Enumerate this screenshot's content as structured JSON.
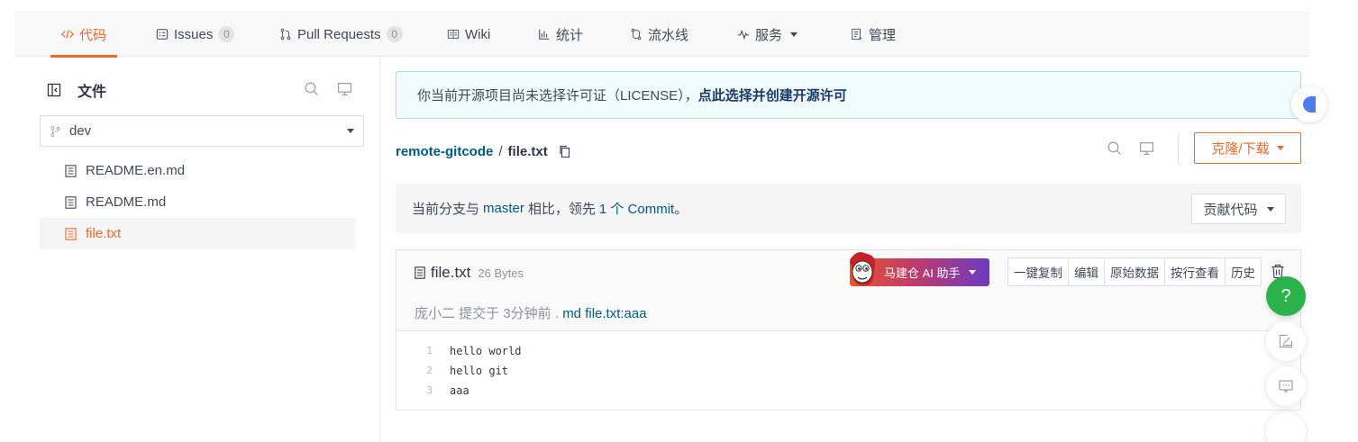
{
  "nav": {
    "tabs": [
      {
        "label": "代码",
        "icon": "code-icon",
        "active": true
      },
      {
        "label": "Issues",
        "icon": "issues-icon",
        "count": "0"
      },
      {
        "label": "Pull Requests",
        "icon": "pull-request-icon",
        "count": "0"
      },
      {
        "label": "Wiki",
        "icon": "wiki-icon"
      },
      {
        "label": "统计",
        "icon": "chart-icon"
      },
      {
        "label": "流水线",
        "icon": "pipeline-icon"
      },
      {
        "label": "服务",
        "icon": "pulse-icon"
      },
      {
        "label": "管理",
        "icon": "manage-icon"
      }
    ]
  },
  "sidebar": {
    "title": "文件",
    "branch": "dev",
    "files": [
      {
        "name": "README.en.md"
      },
      {
        "name": "README.md"
      },
      {
        "name": "file.txt",
        "active": true
      }
    ]
  },
  "license": {
    "text": "你当前开源项目尚未选择许可证（LICENSE），",
    "link": "点此选择并创建开源许可"
  },
  "breadcrumb": {
    "repo": "remote-gitcode",
    "sep": "/",
    "file": "file.txt"
  },
  "clone_button": "克隆/下载",
  "compare": {
    "pre": "当前分支与",
    "branch": "master",
    "mid": "相比，领先",
    "count": "1 个 Commit",
    "post": "。",
    "contribute": "贡献代码"
  },
  "file": {
    "name": "file.txt",
    "size": "26 Bytes",
    "commit_info": "庞小二 提交于 3分钟前 .",
    "commit_msg": "md file.txt:aaa",
    "ai_button": "马建仓 AI 助手",
    "actions": [
      "一键复制",
      "编辑",
      "原始数据",
      "按行查看",
      "历史"
    ],
    "lines": [
      {
        "n": "1",
        "text": "hello world"
      },
      {
        "n": "2",
        "text": "hello git"
      },
      {
        "n": "3",
        "text": "aaa"
      }
    ]
  },
  "helpers": {
    "help": "?"
  },
  "colors": {
    "accent": "#f0682b",
    "link": "#005980",
    "help_green": "#2bb24c"
  }
}
